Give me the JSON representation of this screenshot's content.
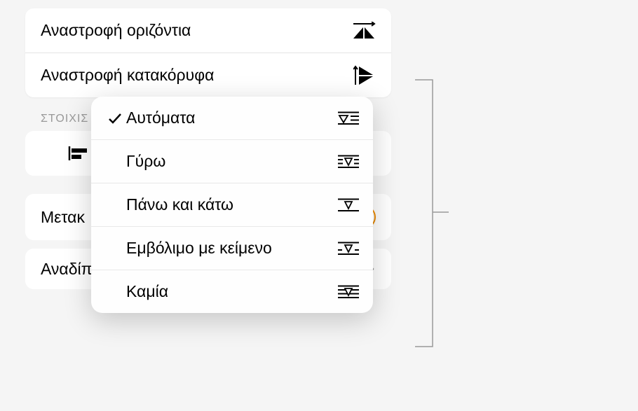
{
  "flip": {
    "horizontal": "Αναστροφή οριζόντια",
    "vertical": "Αναστροφή κατακόρυφα"
  },
  "align_header": "ΣΤΟΙΧΙΣ",
  "move_label": "Μετακ",
  "wrap": {
    "label": "Αναδίπλωση κειμένου",
    "value": "Αυτόματα"
  },
  "popup": {
    "items": [
      {
        "label": "Αυτόματα",
        "checked": true,
        "icon": "wrap-auto"
      },
      {
        "label": "Γύρω",
        "checked": false,
        "icon": "wrap-around"
      },
      {
        "label": "Πάνω και κάτω",
        "checked": false,
        "icon": "wrap-topbottom"
      },
      {
        "label": "Εμβόλιμο με κείμενο",
        "checked": false,
        "icon": "wrap-inline"
      },
      {
        "label": "Καμία",
        "checked": false,
        "icon": "wrap-none"
      }
    ]
  }
}
